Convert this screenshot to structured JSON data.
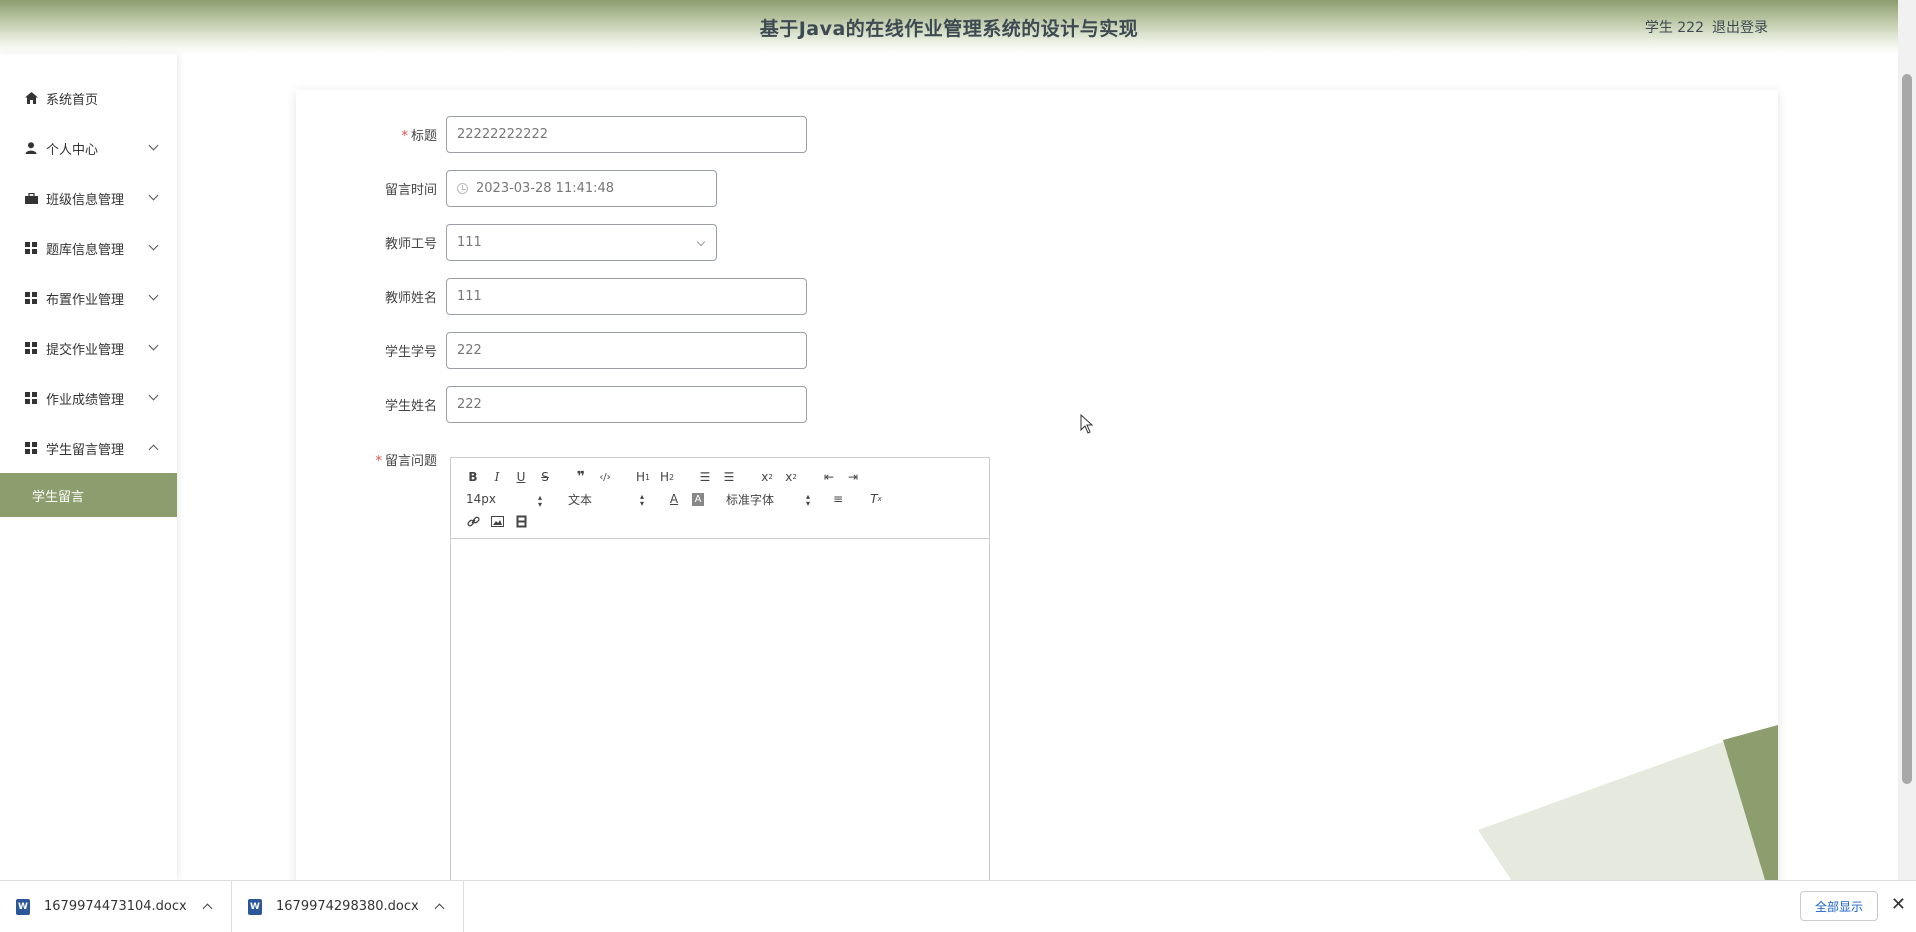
{
  "header": {
    "title": "基于Java的在线作业管理系统的设计与实现",
    "user_label": "学生 222",
    "logout_label": "退出登录"
  },
  "sidebar": {
    "items": [
      {
        "label": "系统首页",
        "icon": "home-icon"
      },
      {
        "label": "个人中心",
        "icon": "user-icon"
      },
      {
        "label": "班级信息管理",
        "icon": "briefcase-icon"
      },
      {
        "label": "题库信息管理",
        "icon": "grid-icon"
      },
      {
        "label": "布置作业管理",
        "icon": "grid-icon"
      },
      {
        "label": "提交作业管理",
        "icon": "grid-icon"
      },
      {
        "label": "作业成绩管理",
        "icon": "grid-icon"
      },
      {
        "label": "学生留言管理",
        "icon": "grid-icon"
      }
    ],
    "active_sub_item": "学生留言"
  },
  "form": {
    "title": {
      "label": "标题",
      "value": "22222222222"
    },
    "time": {
      "label": "留言时间",
      "value": "2023-03-28 11:41:48"
    },
    "teacher_id": {
      "label": "教师工号",
      "value": "111"
    },
    "teacher_name": {
      "label": "教师姓名",
      "value": "111"
    },
    "student_id": {
      "label": "学生学号",
      "value": "222"
    },
    "student_name": {
      "label": "学生姓名",
      "value": "222"
    },
    "question": {
      "label": "留言问题"
    }
  },
  "editor": {
    "font_size": "14px",
    "block_type": "文本",
    "font_family": "标准字体"
  },
  "downloads": {
    "files": [
      "1679974473104.docx",
      "1679974298380.docx"
    ],
    "show_all": "全部显示"
  },
  "colors": {
    "accent": "#8c9d6e",
    "required": "#e04b4b"
  }
}
